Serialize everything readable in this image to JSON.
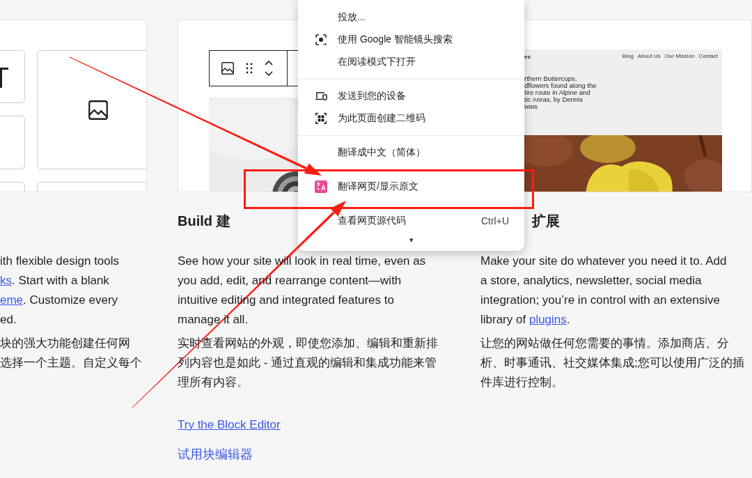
{
  "columns": [
    {
      "kind": "block-tiles",
      "paragraphs": [
        {
          "lines": [
            [
              {
                "text": "ith flexible design tools"
              }
            ],
            [
              {
                "text": "ks",
                "link": true
              },
              {
                "text": ". Start with a blank"
              }
            ],
            [
              {
                "text": "eme",
                "link": true
              },
              {
                "text": ". Customize every"
              }
            ],
            [
              {
                "text": "ed."
              }
            ]
          ]
        },
        {
          "lines": [
            [
              {
                "text": "块的强大功能创建任何网"
              }
            ],
            [
              {
                "text": "选择一个主题。自定义每个"
              }
            ]
          ]
        }
      ]
    },
    {
      "kind": "editor",
      "heading": "Build 建",
      "paragraphs": [
        {
          "lines": [
            [
              {
                "text": "See how your site will look in real time, even as"
              }
            ],
            [
              {
                "text": "you add, edit, and rearrange content—with"
              }
            ],
            [
              {
                "text": "intuitive editing and integrated features to"
              }
            ],
            [
              {
                "text": "manage it all."
              }
            ]
          ]
        },
        {
          "lines": [
            [
              {
                "text": "实时查看网站的外观，即使您添加、编辑和重新排"
              }
            ],
            [
              {
                "text": "列内容也是如此 - 通过直观的编辑和集成功能来管"
              }
            ],
            [
              {
                "text": "理所有内容。"
              }
            ]
          ]
        }
      ],
      "links": [
        "Try the Block Editor",
        "试用块编辑器"
      ]
    },
    {
      "kind": "site-preview",
      "heading": "扩展",
      "preview": {
        "logo": "es",
        "nav": [
          "Blog",
          "About Us",
          "Our Mission",
          "Contact"
        ],
        "title_lines": [
          "rthern Buttercups,",
          "dflowers found along the",
          "tire route in Alpine and",
          "tic Areas, by Dennis",
          "wais"
        ]
      },
      "paragraphs": [
        {
          "lines": [
            [
              {
                "text": "Make your site do whatever you need it to. Add"
              }
            ],
            [
              {
                "text": "a store, analytics, newsletter, social media"
              }
            ],
            [
              {
                "text": "integration; you’re in control with an extensive"
              }
            ],
            [
              {
                "text": "library of "
              },
              {
                "text": "plugins",
                "link": true
              },
              {
                "text": "."
              }
            ]
          ]
        },
        {
          "lines": [
            [
              {
                "text": "让您的网站做任何您需要的事情。添加商店、分"
              }
            ],
            [
              {
                "text": "析、时事通讯、社交媒体集成;您可以使用广泛的插"
              }
            ],
            [
              {
                "text": "件库进行控制。"
              }
            ]
          ]
        }
      ]
    }
  ],
  "context_menu": {
    "groups": [
      {
        "items": [
          {
            "label": "投放..."
          },
          {
            "label": "使用 Google 智能镜头搜索"
          },
          {
            "label": "在阅读模式下打开"
          }
        ]
      },
      {
        "items": [
          {
            "label": "发送到您的设备"
          },
          {
            "label": "为此页面创建二维码"
          }
        ]
      },
      {
        "items": [
          {
            "label": "翻译成中文（简体）"
          }
        ]
      },
      {
        "items": [
          {
            "label": "翻译网页/显示原文"
          }
        ]
      },
      {
        "items": [
          {
            "label": "查看网页源代码",
            "shortcut": "Ctrl+U"
          }
        ]
      }
    ],
    "more": "▾"
  },
  "annotations": [
    {
      "kind": "box"
    },
    {
      "kind": "arrow"
    },
    {
      "kind": "arrow"
    }
  ]
}
